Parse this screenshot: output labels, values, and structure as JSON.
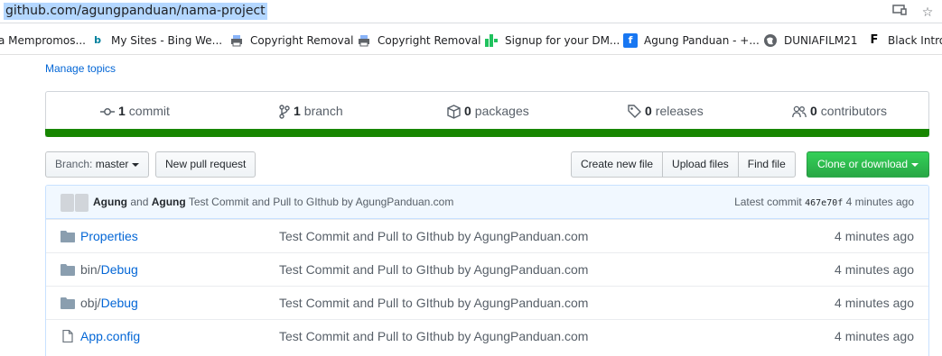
{
  "browser": {
    "url": "github.com/agungpanduan/nama-project",
    "bookmarks": [
      {
        "label": "a Mempromos...",
        "icon": "bookmark-icon"
      },
      {
        "label": "My Sites - Bing We...",
        "icon": "bing-icon"
      },
      {
        "label": "Copyright Removal",
        "icon": "printer-icon"
      },
      {
        "label": "Copyright Removal",
        "icon": "printer-icon"
      },
      {
        "label": "Signup for your DM...",
        "icon": "signup-icon"
      },
      {
        "label": "Agung Panduan - +...",
        "icon": "facebook-icon"
      },
      {
        "label": "DUNIAFILM21",
        "icon": "globe-icon"
      },
      {
        "label": "Black Intro",
        "icon": "flag-icon"
      }
    ]
  },
  "repo": {
    "manage_topics": "Manage topics",
    "summary": {
      "commits_count": "1",
      "commits_label": "commit",
      "branches_count": "1",
      "branches_label": "branch",
      "packages_count": "0",
      "packages_label": "packages",
      "releases_count": "0",
      "releases_label": "releases",
      "contributors_count": "0",
      "contributors_label": "contributors"
    },
    "language_color": "#178600",
    "toolbar": {
      "branch_prefix": "Branch:",
      "branch_name": "master",
      "new_pull_request": "New pull request",
      "create_new_file": "Create new file",
      "upload_files": "Upload files",
      "find_file": "Find file",
      "clone_or_download": "Clone or download"
    },
    "latest_commit": {
      "author1": "Agung",
      "and": "and",
      "author2": "Agung",
      "message": "Test Commit and Pull to GIthub by AgungPanduan.com",
      "prefix": "Latest commit",
      "sha": "467e70f",
      "time": "4 minutes ago"
    },
    "files": [
      {
        "type": "folder",
        "name": "Properties",
        "name_prefix": "",
        "message": "Test Commit and Pull to GIthub by AgungPanduan.com",
        "age": "4 minutes ago"
      },
      {
        "type": "folder",
        "name": "Debug",
        "name_prefix": "bin/",
        "message": "Test Commit and Pull to GIthub by AgungPanduan.com",
        "age": "4 minutes ago"
      },
      {
        "type": "folder",
        "name": "Debug",
        "name_prefix": "obj/",
        "message": "Test Commit and Pull to GIthub by AgungPanduan.com",
        "age": "4 minutes ago"
      },
      {
        "type": "file",
        "name": "App.config",
        "name_prefix": "",
        "message": "Test Commit and Pull to GIthub by AgungPanduan.com",
        "age": "4 minutes ago"
      }
    ]
  }
}
